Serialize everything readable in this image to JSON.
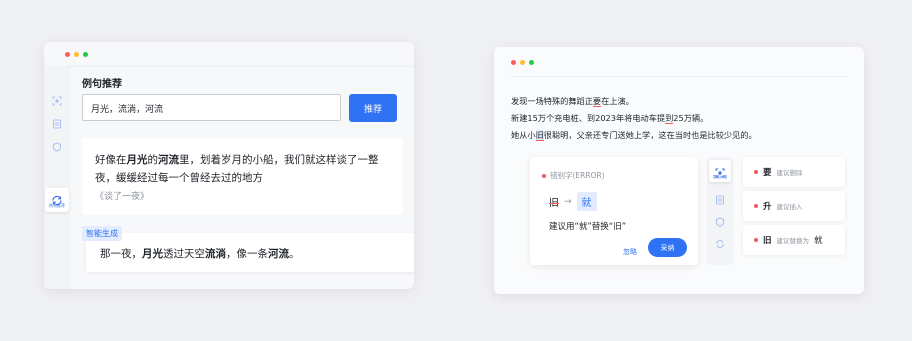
{
  "colors": {
    "accent": "#2f73f4",
    "error": "#f05a5a",
    "dot_red": "#ff5f57",
    "dot_yellow": "#febc2e",
    "dot_green": "#28c840"
  },
  "left": {
    "rail": {
      "icons": [
        "scan-icon",
        "document-icon",
        "shield-icon",
        "refresh-icon"
      ],
      "active_label": "例句推荐"
    },
    "section_title": "例句推荐",
    "keyword_input": {
      "value": "月光，流淌，河流"
    },
    "recommend_button": "推荐",
    "example": {
      "segments": [
        {
          "t": "好像在",
          "b": false
        },
        {
          "t": "月光",
          "b": true
        },
        {
          "t": "的",
          "b": false
        },
        {
          "t": "河流",
          "b": true
        },
        {
          "t": "里，划着岁月的小船，我们就这样谈了一整夜，缓缓经过每一个曾经去过的地方",
          "b": false
        }
      ],
      "source": "《谈了一夜》"
    },
    "generated_tag": "智能生成",
    "generated": {
      "segments": [
        {
          "t": "那一夜，",
          "b": false
        },
        {
          "t": "月光",
          "b": true
        },
        {
          "t": "透过天空",
          "b": false
        },
        {
          "t": "流淌",
          "b": true
        },
        {
          "t": "，像一条",
          "b": false
        },
        {
          "t": "河流",
          "b": true
        },
        {
          "t": "。",
          "b": false
        }
      ]
    }
  },
  "right": {
    "sentences": [
      {
        "pre": "发现一场特殊的舞蹈正",
        "mark": "要",
        "post": "在上演。"
      },
      {
        "pre": "新建15万个充电桩、到2023年将电动车提",
        "mark": "到",
        "post": "25万辆。"
      },
      {
        "pre": "她从小",
        "mark": "旧",
        "post": "很聪明，父亲还专门送她上学，这在当时也是比较少见的。"
      }
    ],
    "error_card": {
      "type": "错别字(ERROR)",
      "wrong": "旧",
      "arrow": "→",
      "correct": "就",
      "suggestion": "建议用“就”替换“旧”",
      "ignore": "忽略",
      "accept": "采纳"
    },
    "mini_rail": {
      "active_label": "智能纠错",
      "icons": [
        "scan-icon",
        "document-icon",
        "shield-icon",
        "refresh-icon"
      ]
    },
    "suggestions": [
      {
        "word": "要",
        "action": "建议删除",
        "extra": ""
      },
      {
        "word": "升",
        "action": "建议插入",
        "extra": ""
      },
      {
        "word": "旧",
        "action": "建议替换为",
        "extra": "就"
      }
    ]
  }
}
